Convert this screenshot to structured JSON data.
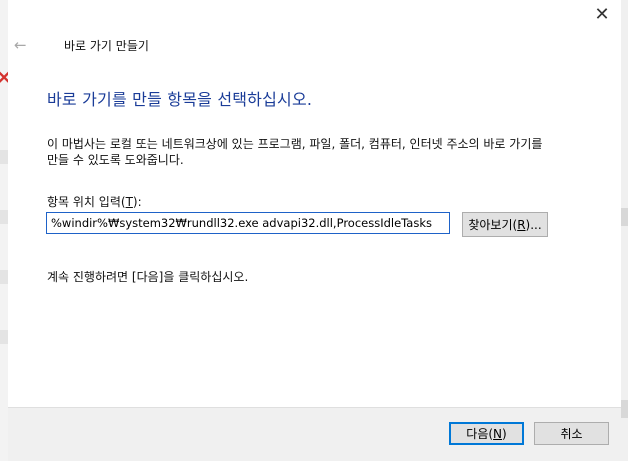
{
  "window": {
    "title": "바로 가기 만들기",
    "close_glyph": "✕",
    "back_glyph": "←"
  },
  "heading": "바로 가기를 만들 항목을 선택하십시오.",
  "description_line1": "이 마법사는 로컬 또는 네트워크상에 있는 프로그램, 파일, 폴더, 컴퓨터, 인터넷 주소의 바로 가기를",
  "description_line2": "만들 수 있도록 도와줍니다.",
  "location": {
    "label_prefix": "항목 위치 입력(",
    "label_key": "T",
    "label_suffix": "):",
    "value": "%windir%₩system32₩rundll32.exe advapi32.dll,ProcessIdleTasks"
  },
  "browse_button": {
    "label_prefix": "찾아보기(",
    "label_key": "R",
    "label_suffix": ")..."
  },
  "continue_text": "계속 진행하려면 [다음]을 클릭하십시오.",
  "buttons": {
    "next_prefix": "다음(",
    "next_key": "N",
    "next_suffix": ")",
    "cancel": "취소"
  },
  "icons": {
    "back": "back-arrow-icon",
    "close": "close-icon",
    "wizard": "shortcut-wizard-icon"
  },
  "colors": {
    "heading": "#1a3c98",
    "input_focus_border": "#1e62c8",
    "primary_button_border": "#0078d7",
    "footer_bg": "#f0f0f0"
  }
}
